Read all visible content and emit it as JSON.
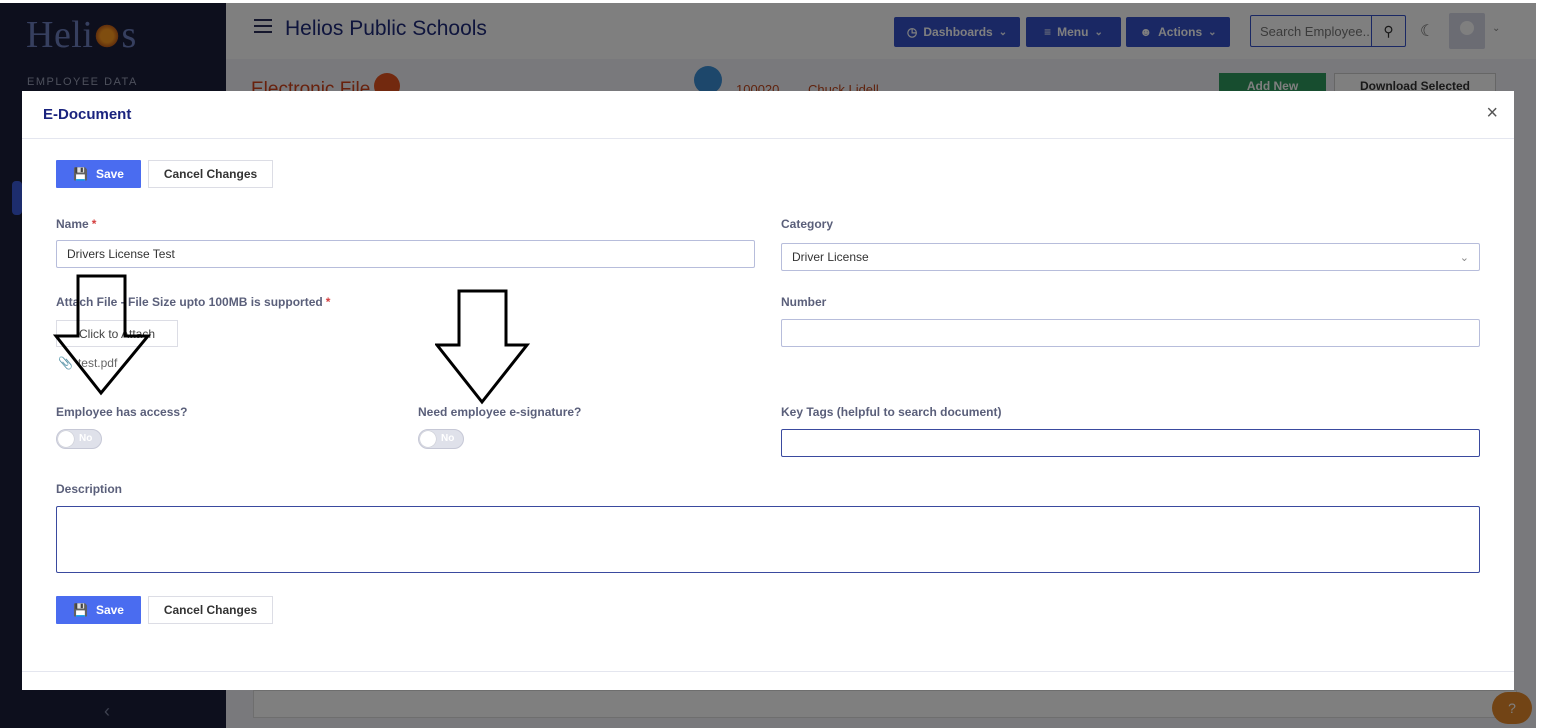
{
  "app": {
    "logo_text": "Helios",
    "sidebar_section": "EMPLOYEE DATA",
    "title": "Helios Public Schools",
    "toolbar": {
      "dashboards": "Dashboards",
      "menu": "Menu",
      "actions": "Actions",
      "search_placeholder": "Search Employee.."
    }
  },
  "background_page": {
    "title": "Electronic File",
    "employee_id": "100020",
    "employee_name": "Chuck Lidell",
    "add_new": "Add New",
    "download_selected": "Download Selected"
  },
  "modal": {
    "title": "E-Document",
    "save_label": "Save",
    "cancel_label": "Cancel Changes",
    "name_label": "Name",
    "name_value": "Drivers License Test",
    "category_label": "Category",
    "category_value": "Driver License",
    "attach_label": "Attach File - File Size upto 100MB is supported",
    "attach_button": "Click to Attach",
    "attached_file": "test.pdf",
    "number_label": "Number",
    "number_value": "",
    "employee_access_label": "Employee has access?",
    "employee_access_value": "No",
    "esignature_label": "Need employee e-signature?",
    "esignature_value": "No",
    "key_tags_label": "Key Tags (helpful to search document)",
    "key_tags_value": "",
    "description_label": "Description",
    "description_value": ""
  },
  "colors": {
    "primary": "#4a6cf0",
    "navy": "#1a237e",
    "sidebar": "#1b1f3a",
    "accent_orange": "#d0421a",
    "required": "#d43f3f"
  }
}
